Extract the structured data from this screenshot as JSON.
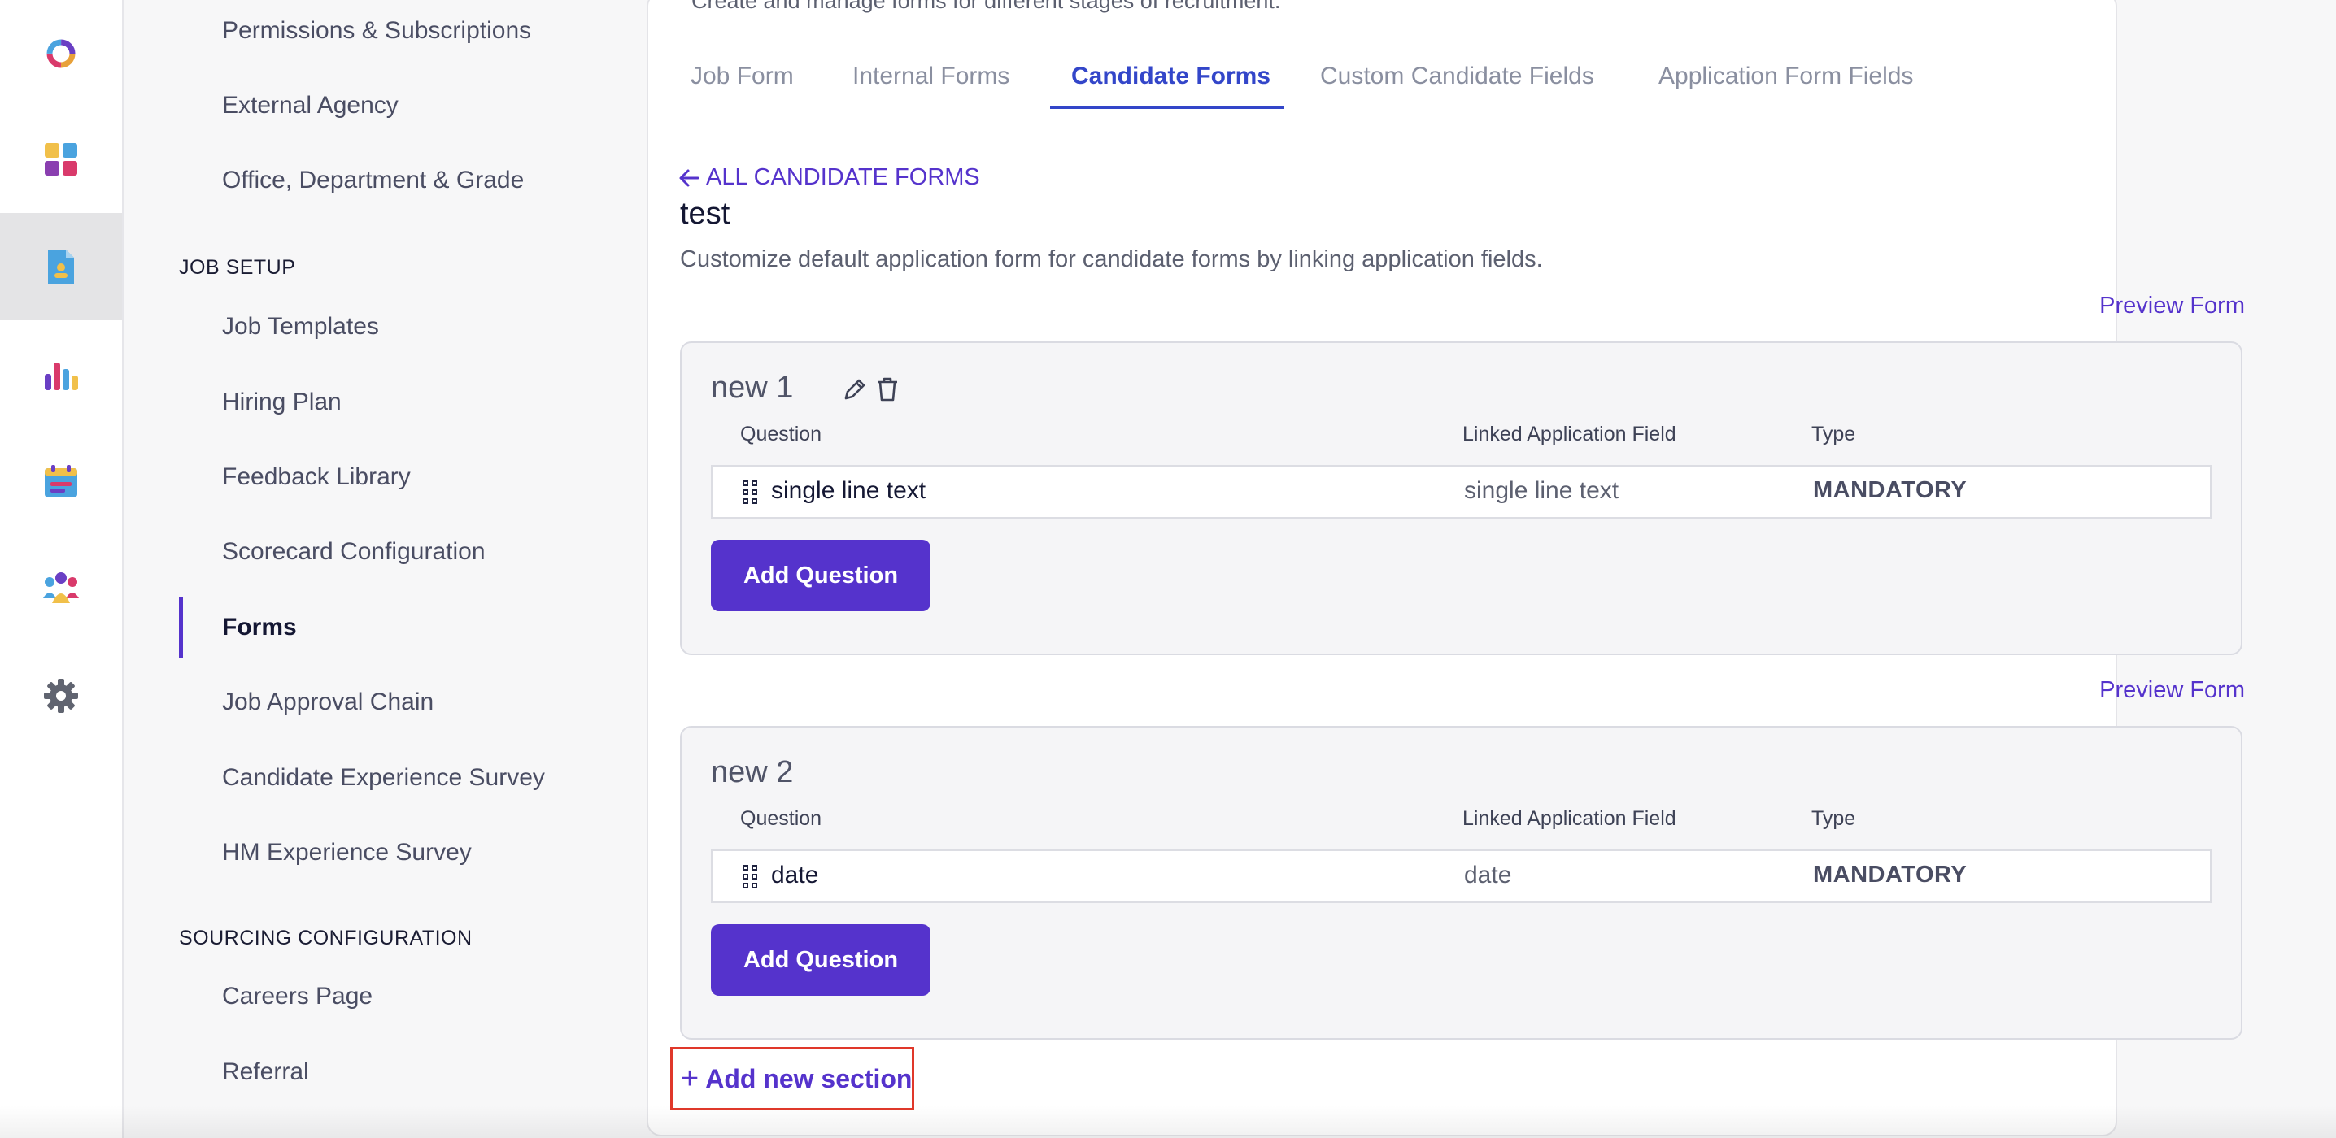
{
  "rail": {
    "icons": [
      "logo-icon",
      "dashboard-icon",
      "jobs-document-icon",
      "analytics-icon",
      "calendar-icon",
      "team-icon",
      "settings-gear-icon"
    ]
  },
  "nav": {
    "items_top": [
      "Permissions & Subscriptions",
      "External Agency",
      "Office, Department & Grade"
    ],
    "job_setup_heading": "JOB SETUP",
    "job_setup_items": [
      "Job Templates",
      "Hiring Plan",
      "Feedback Library",
      "Scorecard Configuration",
      "Forms",
      "Job Approval Chain",
      "Candidate Experience Survey",
      "HM Experience Survey"
    ],
    "active_item": "Forms",
    "sourcing_heading": "SOURCING CONFIGURATION",
    "sourcing_items": [
      "Careers Page",
      "Referral"
    ]
  },
  "main": {
    "description": "Create and manage forms for different stages of recruitment.",
    "tabs": [
      "Job Form",
      "Internal Forms",
      "Candidate Forms",
      "Custom Candidate Fields",
      "Application Form Fields"
    ],
    "active_tab": "Candidate Forms",
    "back_link": "ALL CANDIDATE FORMS",
    "form_title": "test",
    "form_subtitle": "Customize default application form for candidate forms by linking application fields.",
    "preview_label": "Preview Form",
    "columns": {
      "question": "Question",
      "linked": "Linked Application Field",
      "type": "Type"
    },
    "sections": [
      {
        "title": "new 1",
        "questions": [
          {
            "question": "single line text",
            "linked": "single line text",
            "type": "MANDATORY"
          }
        ],
        "add_question_label": "Add Question"
      },
      {
        "title": "new 2",
        "questions": [
          {
            "question": "date",
            "linked": "date",
            "type": "MANDATORY"
          }
        ],
        "add_question_label": "Add Question"
      }
    ],
    "add_section_label": "Add new section"
  },
  "colors": {
    "accent": "#5533cc",
    "tab_active": "#3346c9",
    "highlight_border": "#e0382a"
  }
}
